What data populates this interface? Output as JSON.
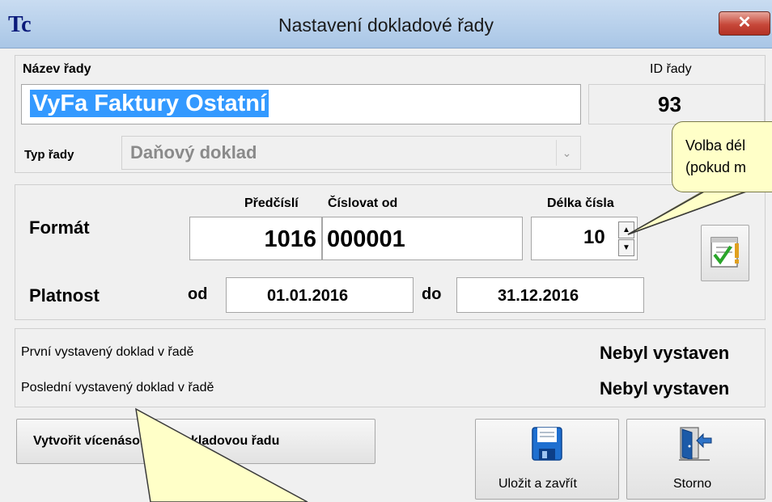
{
  "window": {
    "title": "Nastavení dokladové řady",
    "app_icon_letters": "Tc",
    "close_glyph": "✕"
  },
  "series": {
    "name_label": "Název řady",
    "name_value": "VyFa Faktury Ostatní",
    "id_label": "ID řady",
    "id_value": "93",
    "type_label": "Typ řady",
    "type_value": "Daňový doklad"
  },
  "format": {
    "section_label": "Formát",
    "prefix_label": "Předčíslí",
    "number_from_label": "Číslovat od",
    "length_label": "Délka čísla",
    "prefix_value": "1016",
    "number_from_value": "000001",
    "length_value": "10",
    "spin_up": "▲",
    "spin_down": "▼"
  },
  "validity": {
    "section_label": "Platnost",
    "from_label": "od",
    "from_value": "01.01.2016",
    "to_label": "do",
    "to_value": "31.12.2016"
  },
  "info": {
    "first_label": "První vystavený doklad v řadě",
    "first_value": "Nebyl vystaven",
    "last_label": "Poslední vystavený doklad v řadě",
    "last_value": "Nebyl vystaven"
  },
  "buttons": {
    "create_multiple": "Vytvořit vícenásobnou dokladovou řadu",
    "save_close": "Uložit a zavřít",
    "cancel": "Storno"
  },
  "callout": {
    "line1": "Volba dél",
    "line2": "(pokud m"
  },
  "colors": {
    "selection": "#3399ff",
    "callout_bg": "#ffffc8",
    "close_red": "#c7483a"
  }
}
